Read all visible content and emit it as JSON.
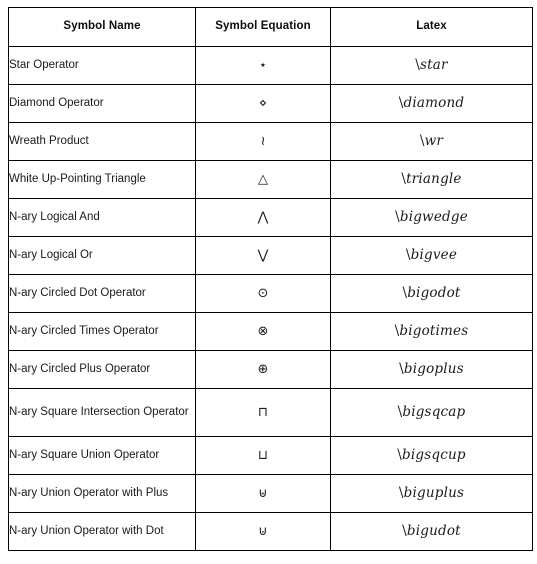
{
  "table": {
    "columns": [
      {
        "key": "symbol_name",
        "label": "Symbol Name",
        "align": "center"
      },
      {
        "key": "symbol_equation",
        "label": "Symbol Equation",
        "align": "center"
      },
      {
        "key": "latex",
        "label": "Latex",
        "align": "center"
      }
    ],
    "rows": [
      {
        "symbol_name": "Star Operator",
        "symbol_equation": "⋆",
        "latex": "\\star"
      },
      {
        "symbol_name": "Diamond Operator",
        "symbol_equation": "⋄",
        "latex": "\\diamond"
      },
      {
        "symbol_name": "Wreath Product",
        "symbol_equation": "≀",
        "latex": "\\wr"
      },
      {
        "symbol_name": "White Up-Pointing Triangle",
        "symbol_equation": "△",
        "latex": "\\triangle"
      },
      {
        "symbol_name": "N-ary Logical And",
        "symbol_equation": "⋀",
        "latex": "\\bigwedge"
      },
      {
        "symbol_name": "N-ary Logical Or",
        "symbol_equation": "⋁",
        "latex": "\\bigvee"
      },
      {
        "symbol_name": "N-ary Circled Dot Operator",
        "symbol_equation": "⊙",
        "latex": "\\bigodot"
      },
      {
        "symbol_name": "N-ary Circled Times Operator",
        "symbol_equation": "⊗",
        "latex": "\\bigotimes"
      },
      {
        "symbol_name": "N-ary Circled Plus Operator",
        "symbol_equation": "⊕",
        "latex": "\\bigoplus"
      },
      {
        "symbol_name": "N-ary Square Intersection Operator",
        "symbol_equation": "⊓",
        "latex": "\\bigsqcap",
        "tall": true
      },
      {
        "symbol_name": "N-ary Square Union Operator",
        "symbol_equation": "⊔",
        "latex": "\\bigsqcup"
      },
      {
        "symbol_name": "N-ary Union Operator with Plus",
        "symbol_equation": "⊎",
        "latex": "\\biguplus"
      },
      {
        "symbol_name": "N-ary Union Operator with Dot",
        "symbol_equation": "⊍",
        "latex": "\\bigudot"
      }
    ]
  },
  "style": {
    "border_color": "#000000",
    "text_color": "#1a1a1a",
    "header_text_color": "#0d0d0d",
    "background": "#ffffff"
  }
}
